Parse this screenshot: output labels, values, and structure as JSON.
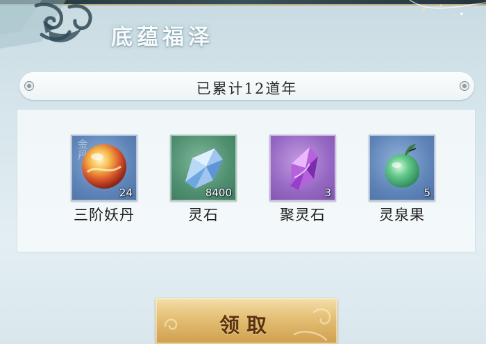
{
  "header": {
    "title": "底蕴福泽"
  },
  "progress": {
    "text": "已累计12道年"
  },
  "rewards": [
    {
      "name": "三阶妖丹",
      "count": "24",
      "quality": "金丹",
      "icon": "demon-core-icon",
      "bg": "#5f84b8"
    },
    {
      "name": "灵石",
      "count": "8400",
      "icon": "spirit-stone-icon",
      "bg": "#4f8f70"
    },
    {
      "name": "聚灵石",
      "count": "3",
      "icon": "gathering-stone-icon",
      "bg": "#9467c3"
    },
    {
      "name": "灵泉果",
      "count": "5",
      "icon": "spring-fruit-icon",
      "bg": "#5f84b8"
    }
  ],
  "claim_button": {
    "label": "领取"
  },
  "colors": {
    "title": "#f7fbfc",
    "button_gold": "#e3be73",
    "button_text": "#5a3210"
  }
}
